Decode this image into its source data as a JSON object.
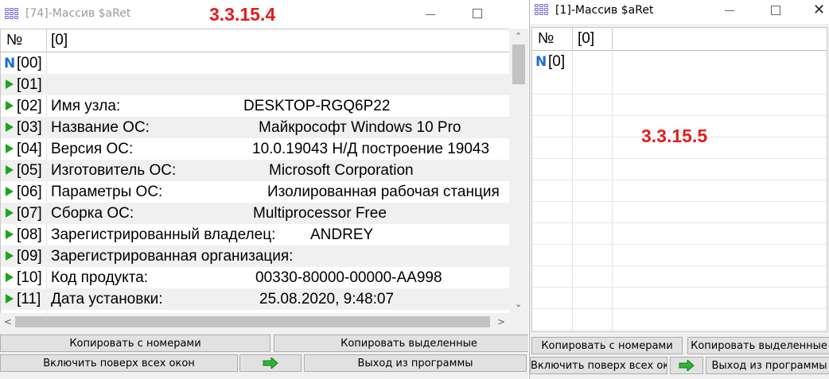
{
  "window_left": {
    "title": "[74]-Массив $aRet",
    "version_label": "3.3.15.4",
    "header": {
      "col_no": "№",
      "col_0": "[0]"
    },
    "rows": [
      {
        "idx": "[00]",
        "icon": "n",
        "label": "",
        "value": ""
      },
      {
        "idx": "[01]",
        "icon": "arrow",
        "label": "",
        "value": ""
      },
      {
        "idx": "[02]",
        "icon": "arrow",
        "label": "Имя узла:",
        "value": "DESKTOP-RGQ6P22"
      },
      {
        "idx": "[03]",
        "icon": "arrow",
        "label": "Название ОС:",
        "value": "Майкрософт Windows 10 Pro"
      },
      {
        "idx": "[04]",
        "icon": "arrow",
        "label": "Версия ОС:",
        "value": "10.0.19043 Н/Д построение 19043"
      },
      {
        "idx": "[05]",
        "icon": "arrow",
        "label": "Изготовитель ОС:",
        "value": "Microsoft Corporation"
      },
      {
        "idx": "[06]",
        "icon": "arrow",
        "label": "Параметры ОС:",
        "value": "Изолированная рабочая станция"
      },
      {
        "idx": "[07]",
        "icon": "arrow",
        "label": "Сборка ОС:",
        "value": "Multiprocessor Free"
      },
      {
        "idx": "[08]",
        "icon": "arrow",
        "label": "Зарегистрированный владелец:",
        "value": "ANDREY"
      },
      {
        "idx": "[09]",
        "icon": "arrow",
        "label": "Зарегистрированная организация:",
        "value": ""
      },
      {
        "idx": "[10]",
        "icon": "arrow",
        "label": "Код продукта:",
        "value": "00330-80000-00000-AA998"
      },
      {
        "idx": "[11]",
        "icon": "arrow",
        "label": "Дата установки:",
        "value": "25.08.2020, 9:48:07"
      }
    ],
    "buttons": {
      "copy_with_numbers": "Копировать с номерами",
      "copy_selected": "Копировать выделенные",
      "always_on_top": "Включить поверх всех окон",
      "exit": "Выход из программы"
    }
  },
  "window_right": {
    "title": "[1]-Массив $aRet",
    "version_label": "3.3.15.5",
    "header": {
      "col_no": "№",
      "col_0": "[0]"
    },
    "rows": [
      {
        "idx": "[0]",
        "icon": "n"
      }
    ],
    "buttons": {
      "copy_with_numbers": "Копировать с номерами",
      "copy_selected": "Копировать выделенные",
      "always_on_top": "Включить поверх всех окон",
      "exit": "Выход из программы"
    }
  },
  "icons": {
    "app": "array-grid-icon",
    "row_marker": "green-arrow-icon",
    "n_marker": "n-icon",
    "minimize": "minimize-icon",
    "maximize": "maximize-icon",
    "close": "close-icon",
    "go": "green-arrow-right-icon"
  },
  "colors": {
    "version_label": "#e51c1c",
    "row_arrow": "#1aa51a",
    "n_icon": "#1a6fd6"
  }
}
